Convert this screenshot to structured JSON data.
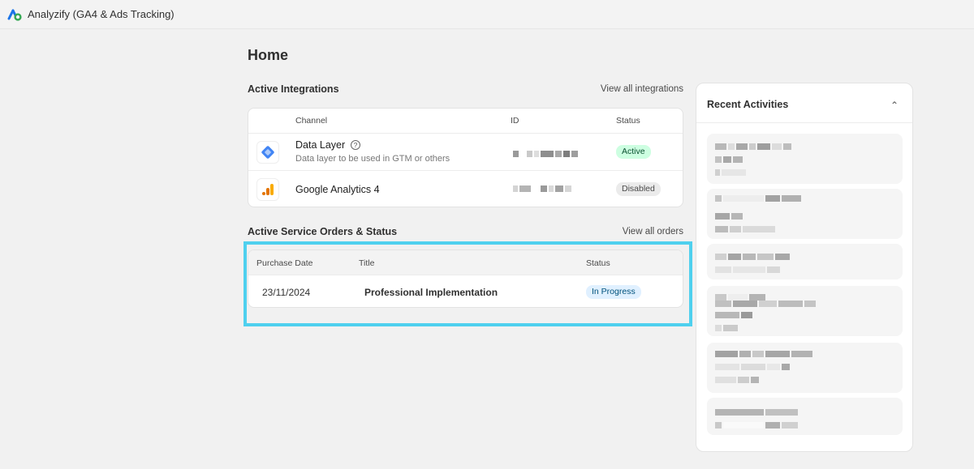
{
  "app": {
    "title": "Analyzify (GA4 & Ads Tracking)"
  },
  "page": {
    "title": "Home"
  },
  "integrations": {
    "title": "Active Integrations",
    "view_all": "View all integrations",
    "columns": {
      "channel": "Channel",
      "id": "ID",
      "status": "Status"
    },
    "rows": [
      {
        "name": "Data Layer",
        "subtitle": "Data layer to be used in GTM or others",
        "status": "Active",
        "icon": "data-layer-icon",
        "help_icon": "question-circle-icon"
      },
      {
        "name": "Google Analytics 4",
        "subtitle": "",
        "status": "Disabled",
        "icon": "google-analytics-icon"
      }
    ]
  },
  "orders": {
    "title": "Active Service Orders & Status",
    "view_all": "View all orders",
    "columns": {
      "date": "Purchase Date",
      "title": "Title",
      "status": "Status"
    },
    "rows": [
      {
        "date": "23/11/2024",
        "title": "Professional Implementation",
        "status": "In Progress"
      }
    ]
  },
  "recent": {
    "title": "Recent Activities",
    "collapse_icon": "chevron-up-icon",
    "chevron": "⌃"
  },
  "colors": {
    "highlight": "#4fd0ee",
    "active_badge_bg": "#cdfee1",
    "progress_badge_bg": "#e0f0ff"
  }
}
